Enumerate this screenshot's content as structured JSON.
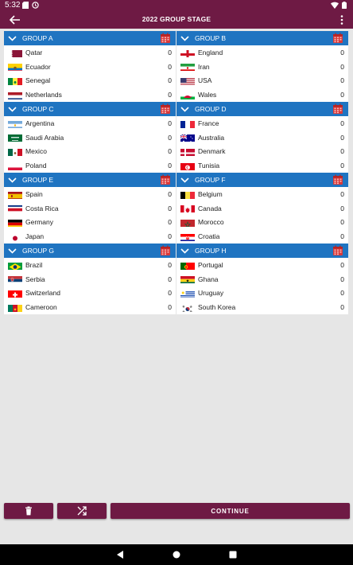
{
  "status": {
    "time": "5:32"
  },
  "appbar": {
    "title": "2022 GROUP STAGE"
  },
  "groups": [
    {
      "name": "GROUP A",
      "teams": [
        {
          "name": "Qatar",
          "pts": "0",
          "flag": "qatar"
        },
        {
          "name": "Ecuador",
          "pts": "0",
          "flag": "ecuador"
        },
        {
          "name": "Senegal",
          "pts": "0",
          "flag": "senegal"
        },
        {
          "name": "Netherlands",
          "pts": "0",
          "flag": "netherlands"
        }
      ]
    },
    {
      "name": "GROUP B",
      "teams": [
        {
          "name": "England",
          "pts": "0",
          "flag": "england"
        },
        {
          "name": "Iran",
          "pts": "0",
          "flag": "iran"
        },
        {
          "name": "USA",
          "pts": "0",
          "flag": "usa"
        },
        {
          "name": "Wales",
          "pts": "0",
          "flag": "wales"
        }
      ]
    },
    {
      "name": "GROUP C",
      "teams": [
        {
          "name": "Argentina",
          "pts": "0",
          "flag": "argentina"
        },
        {
          "name": "Saudi Arabia",
          "pts": "0",
          "flag": "saudi"
        },
        {
          "name": "Mexico",
          "pts": "0",
          "flag": "mexico"
        },
        {
          "name": "Poland",
          "pts": "0",
          "flag": "poland"
        }
      ]
    },
    {
      "name": "GROUP D",
      "teams": [
        {
          "name": "France",
          "pts": "0",
          "flag": "france"
        },
        {
          "name": "Australia",
          "pts": "0",
          "flag": "australia"
        },
        {
          "name": "Denmark",
          "pts": "0",
          "flag": "denmark"
        },
        {
          "name": "Tunisia",
          "pts": "0",
          "flag": "tunisia"
        }
      ]
    },
    {
      "name": "GROUP E",
      "teams": [
        {
          "name": "Spain",
          "pts": "0",
          "flag": "spain"
        },
        {
          "name": "Costa Rica",
          "pts": "0",
          "flag": "costarica"
        },
        {
          "name": "Germany",
          "pts": "0",
          "flag": "germany"
        },
        {
          "name": "Japan",
          "pts": "0",
          "flag": "japan"
        }
      ]
    },
    {
      "name": "GROUP F",
      "teams": [
        {
          "name": "Belgium",
          "pts": "0",
          "flag": "belgium"
        },
        {
          "name": "Canada",
          "pts": "0",
          "flag": "canada"
        },
        {
          "name": "Morocco",
          "pts": "0",
          "flag": "morocco"
        },
        {
          "name": "Croatia",
          "pts": "0",
          "flag": "croatia"
        }
      ]
    },
    {
      "name": "GROUP G",
      "teams": [
        {
          "name": "Brazil",
          "pts": "0",
          "flag": "brazil"
        },
        {
          "name": "Serbia",
          "pts": "0",
          "flag": "serbia"
        },
        {
          "name": "Switzerland",
          "pts": "0",
          "flag": "switzerland"
        },
        {
          "name": "Cameroon",
          "pts": "0",
          "flag": "cameroon"
        }
      ]
    },
    {
      "name": "GROUP H",
      "teams": [
        {
          "name": "Portugal",
          "pts": "0",
          "flag": "portugal"
        },
        {
          "name": "Ghana",
          "pts": "0",
          "flag": "ghana"
        },
        {
          "name": "Uruguay",
          "pts": "0",
          "flag": "uruguay"
        },
        {
          "name": "South Korea",
          "pts": "0",
          "flag": "southkorea"
        }
      ]
    }
  ],
  "buttons": {
    "continue_label": "CONTINUE"
  },
  "colors": {
    "primary": "#6e1a44",
    "group_header": "#1f74c1",
    "background": "#e6e6e6"
  }
}
